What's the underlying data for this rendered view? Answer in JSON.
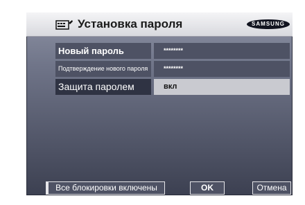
{
  "dialog": {
    "title": "Установка пароля",
    "brand": "SAMSUNG",
    "icon": "remote-control-icon"
  },
  "rows": [
    {
      "label": "Новый пароль",
      "value": "********"
    },
    {
      "label": "Подтверждение нового пароля",
      "value": "********"
    },
    {
      "label": "Защита паролем",
      "value": "вкл"
    }
  ],
  "footer": {
    "status_label": "Все блокировки включены",
    "ok_label": "OK",
    "cancel_label": "Отмена"
  }
}
